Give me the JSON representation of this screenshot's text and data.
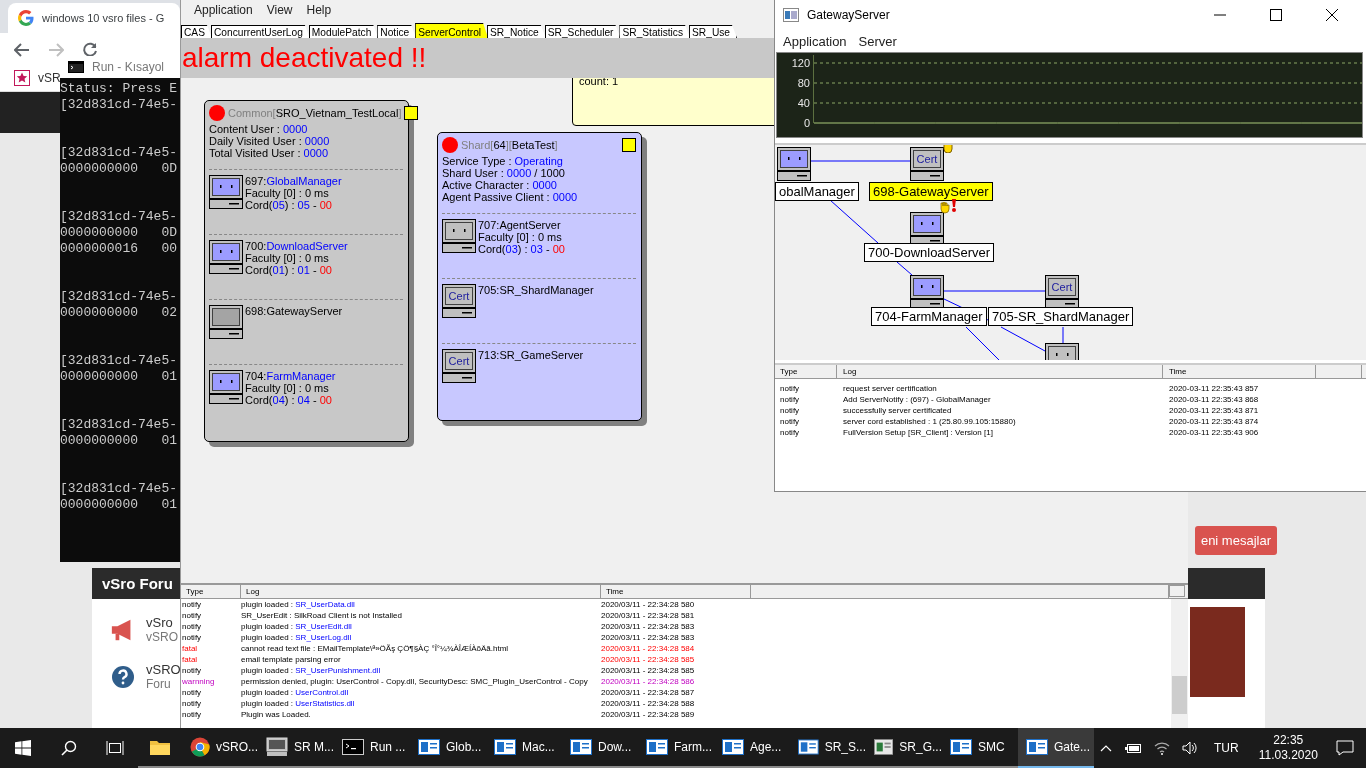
{
  "browser": {
    "tab_title": "windows 10 vsro files - G",
    "bookmark": "vSR",
    "new_messages_button": "eni mesajlar",
    "forum": {
      "title": "vSro Foru",
      "items": [
        {
          "kind": "announce",
          "title": "vSro",
          "subtitle": "vSRO"
        },
        {
          "kind": "help",
          "title": "vSRO",
          "subtitle": "Foru"
        }
      ]
    }
  },
  "console": {
    "title": "Run - Kısayol",
    "blocks": [
      [
        "Status: Press E",
        "[32d831cd-74e5-"
      ],
      [
        "[32d831cd-74e5-",
        "0000000000   0D"
      ],
      [
        "[32d831cd-74e5-",
        "0000000000   0D",
        "0000000016   00"
      ],
      [
        "[32d831cd-74e5-",
        "0000000000   02"
      ],
      [
        "[32d831cd-74e5-",
        "0000000000   01"
      ],
      [
        "[32d831cd-74e5-",
        "0000000000   01"
      ],
      [
        "[32d831cd-74e5-",
        "0000000000   01"
      ]
    ]
  },
  "smc": {
    "menu": [
      "Application",
      "View",
      "Help"
    ],
    "tabs": [
      {
        "label": "CAS",
        "selected": false
      },
      {
        "label": "ConcurrentUserLog",
        "selected": false
      },
      {
        "label": "ModulePatch",
        "selected": false
      },
      {
        "label": "Notice",
        "selected": false
      },
      {
        "label": "ServerControl",
        "selected": true
      },
      {
        "label": "SR_Notice",
        "selected": false
      },
      {
        "label": "SR_Scheduler",
        "selected": false
      },
      {
        "label": "SR_Statistics",
        "selected": false
      },
      {
        "label": "SR_Use",
        "selected": false
      }
    ],
    "alarm": "alarm deactivated !!",
    "note": "count: 1",
    "panels": [
      {
        "kind": "common",
        "color": "#ff0000",
        "flag": true,
        "header": [
          {
            "text": "Common[",
            "kind": "muted"
          },
          {
            "text": "SRO_Vietnam_TestLocal",
            "kind": "plain"
          },
          {
            "text": "]",
            "kind": "muted"
          }
        ],
        "stats": [
          [
            {
              "text": "Content User : ",
              "kind": "plain"
            },
            {
              "text": "0000",
              "kind": "link"
            }
          ],
          [
            {
              "text": "Daily Visited User : ",
              "kind": "plain"
            },
            {
              "text": "0000",
              "kind": "link"
            }
          ],
          [
            {
              "text": "Total Visited User : ",
              "kind": "plain"
            },
            {
              "text": "0000",
              "kind": "link"
            }
          ]
        ],
        "servers": [
          {
            "kind": "online",
            "lines": [
              [
                {
                  "text": "697:",
                  "kind": "plain"
                },
                {
                  "text": "GlobalManager",
                  "kind": "link"
                }
              ],
              [
                {
                  "text": "Faculty [0] : 0 ms",
                  "kind": "plain"
                }
              ],
              [
                {
                  "text": "Cord(",
                  "kind": "plain"
                },
                {
                  "text": "05",
                  "kind": "link"
                },
                {
                  "text": ") : ",
                  "kind": "plain"
                },
                {
                  "text": "05",
                  "kind": "link"
                },
                {
                  "text": " - ",
                  "kind": "plain"
                },
                {
                  "text": "00",
                  "kind": "alert"
                }
              ]
            ]
          },
          {
            "kind": "online",
            "lines": [
              [
                {
                  "text": "700:",
                  "kind": "plain"
                },
                {
                  "text": "DownloadServer",
                  "kind": "link"
                }
              ],
              [
                {
                  "text": "Faculty [0] : 0 ms",
                  "kind": "plain"
                }
              ],
              [
                {
                  "text": "Cord(",
                  "kind": "plain"
                },
                {
                  "text": "01",
                  "kind": "link"
                },
                {
                  "text": ") : ",
                  "kind": "plain"
                },
                {
                  "text": "01",
                  "kind": "link"
                },
                {
                  "text": " - ",
                  "kind": "plain"
                },
                {
                  "text": "00",
                  "kind": "alert"
                }
              ]
            ]
          },
          {
            "kind": "unknown",
            "lines": [
              [
                {
                  "text": "698:GatewayServer",
                  "kind": "plain"
                }
              ]
            ]
          },
          {
            "kind": "online",
            "lines": [
              [
                {
                  "text": "704:",
                  "kind": "plain"
                },
                {
                  "text": "FarmManager",
                  "kind": "link"
                }
              ],
              [
                {
                  "text": "Faculty [0] : 0 ms",
                  "kind": "plain"
                }
              ],
              [
                {
                  "text": "Cord(",
                  "kind": "plain"
                },
                {
                  "text": "04",
                  "kind": "link"
                },
                {
                  "text": ") : ",
                  "kind": "plain"
                },
                {
                  "text": "04",
                  "kind": "link"
                },
                {
                  "text": " - ",
                  "kind": "plain"
                },
                {
                  "text": "00",
                  "kind": "alert"
                }
              ]
            ]
          }
        ]
      },
      {
        "kind": "shard",
        "color": "#ff0000",
        "flag": true,
        "header": [
          {
            "text": "Shard[",
            "kind": "muted"
          },
          {
            "text": "64",
            "kind": "plain"
          },
          {
            "text": "][",
            "kind": "muted"
          },
          {
            "text": "BetaTest",
            "kind": "plain"
          },
          {
            "text": "]",
            "kind": "muted"
          }
        ],
        "stats": [
          [
            {
              "text": "Service Type : ",
              "kind": "plain"
            },
            {
              "text": "Operating",
              "kind": "link"
            }
          ],
          [
            {
              "text": "Shard User : ",
              "kind": "plain"
            },
            {
              "text": "0000",
              "kind": "link"
            },
            {
              "text": " / 1000",
              "kind": "plain"
            }
          ],
          [
            {
              "text": "Active Character : ",
              "kind": "plain"
            },
            {
              "text": "0000",
              "kind": "link"
            }
          ],
          [
            {
              "text": "Agent Passive Client : ",
              "kind": "plain"
            },
            {
              "text": "0000",
              "kind": "link"
            }
          ]
        ],
        "servers": [
          {
            "kind": "offline",
            "lines": [
              [
                {
                  "text": "707:AgentServer",
                  "kind": "plain"
                }
              ],
              [
                {
                  "text": "Faculty [0] : 0 ms",
                  "kind": "plain"
                }
              ],
              [
                {
                  "text": "Cord(",
                  "kind": "plain"
                },
                {
                  "text": "03",
                  "kind": "link"
                },
                {
                  "text": ") : ",
                  "kind": "plain"
                },
                {
                  "text": "03",
                  "kind": "link"
                },
                {
                  "text": " - ",
                  "kind": "plain"
                },
                {
                  "text": "00",
                  "kind": "alert"
                }
              ]
            ]
          },
          {
            "kind": "cert",
            "screen_text": "Cert",
            "lines": [
              [
                {
                  "text": "705:SR_ShardManager",
                  "kind": "plain"
                }
              ]
            ]
          },
          {
            "kind": "cert",
            "screen_text": "Cert",
            "lines": [
              [
                {
                  "text": "713:SR_GameServer",
                  "kind": "plain"
                }
              ]
            ]
          }
        ]
      }
    ],
    "log": {
      "columns": [
        "Type",
        "Log",
        "Time"
      ],
      "rows": [
        {
          "kind": "notify",
          "type": "notify",
          "log": [
            {
              "text": "plugin loaded : ",
              "kind": "plain"
            },
            {
              "text": "SR_UserData.dll",
              "kind": "link"
            }
          ],
          "time": "2020/03/11 - 22:34:28 580"
        },
        {
          "kind": "notify",
          "type": "notify",
          "log": [
            {
              "text": "SR_UserEdit : SilkRoad Client is not Installed",
              "kind": "plain"
            }
          ],
          "time": "2020/03/11 - 22:34:28 581"
        },
        {
          "kind": "notify",
          "type": "notify",
          "log": [
            {
              "text": "plugin loaded : ",
              "kind": "plain"
            },
            {
              "text": "SR_UserEdit.dll",
              "kind": "link"
            }
          ],
          "time": "2020/03/11 - 22:34:28 583"
        },
        {
          "kind": "notify",
          "type": "notify",
          "log": [
            {
              "text": "plugin loaded : ",
              "kind": "plain"
            },
            {
              "text": "SR_UserLog.dll",
              "kind": "link"
            }
          ],
          "time": "2020/03/11 - 22:34:28 583"
        },
        {
          "kind": "fatal",
          "type": "fatal",
          "log": [
            {
              "text": "cannot read text file : EMailTemplate\\ª»ÖÃş ÇÖ¶§ÀÇ °Î°¼¾ÀÎÆÍÀõÄã.html",
              "kind": "plain"
            }
          ],
          "time": "2020/03/11 - 22:34:28 584"
        },
        {
          "kind": "fatal",
          "type": "fatal",
          "log": [
            {
              "text": "email template parsing error",
              "kind": "plain"
            }
          ],
          "time": "2020/03/11 - 22:34:28 585"
        },
        {
          "kind": "notify",
          "type": "notify",
          "log": [
            {
              "text": "plugin loaded : ",
              "kind": "plain"
            },
            {
              "text": "SR_UserPunishment.dll",
              "kind": "link"
            }
          ],
          "time": "2020/03/11 - 22:34:28 585"
        },
        {
          "kind": "warning",
          "type": "warnning",
          "log": [
            {
              "text": "permission denied, plugin: UserControl - Copy.dll, SecurityDesc: SMC_Plugin_UserControl - Copy",
              "kind": "plain"
            }
          ],
          "time": "2020/03/11 - 22:34:28 586"
        },
        {
          "kind": "notify",
          "type": "notify",
          "log": [
            {
              "text": "plugin loaded : ",
              "kind": "plain"
            },
            {
              "text": "UserControl.dll",
              "kind": "link"
            }
          ],
          "time": "2020/03/11 - 22:34:28 587"
        },
        {
          "kind": "notify",
          "type": "notify",
          "log": [
            {
              "text": "plugin loaded : ",
              "kind": "plain"
            },
            {
              "text": "UserStatistics.dll",
              "kind": "link"
            }
          ],
          "time": "2020/03/11 - 22:34:28 588"
        },
        {
          "kind": "notify",
          "type": "notify",
          "log": [
            {
              "text": "Plugin was Loaded.",
              "kind": "plain"
            }
          ],
          "time": "2020/03/11 - 22:34:28 589"
        }
      ]
    }
  },
  "gateway": {
    "title": "GatewayServer",
    "menu": [
      "Application",
      "Server"
    ],
    "chart_data": {
      "type": "line",
      "yticks": [
        0,
        40,
        80,
        120
      ],
      "ylim": [
        0,
        120
      ],
      "values": [
        0,
        0,
        0,
        0,
        0,
        0,
        0,
        0,
        0,
        0
      ]
    },
    "nodes": [
      {
        "kind": "online",
        "label": "obalManager",
        "highlighted": false
      },
      {
        "kind": "cert",
        "screen_text": "Cert",
        "label": "698-GatewayServer",
        "highlighted": true
      },
      {
        "kind": "online",
        "label": "700-DownloadServer",
        "highlighted": false
      },
      {
        "kind": "online",
        "label": "704-FarmManager",
        "highlighted": false
      },
      {
        "kind": "cert",
        "screen_text": "Cert",
        "label": "705-SR_ShardManager",
        "highlighted": false
      },
      {
        "kind": "offline"
      }
    ],
    "log": {
      "columns": [
        "Type",
        "Log",
        "Time"
      ],
      "rows": [
        {
          "type": "notify",
          "log": "request server certification",
          "time": "2020-03-11 22:35:43 857"
        },
        {
          "type": "notify",
          "log": "Add ServerNotify : (697) - GlobalManager",
          "time": "2020-03-11 22:35:43 868"
        },
        {
          "type": "notify",
          "log": "successfully server certificated",
          "time": "2020-03-11 22:35:43 871"
        },
        {
          "type": "notify",
          "log": "server cord established : 1 (25.80.99.105:15880)",
          "time": "2020-03-11 22:35:43 874"
        },
        {
          "type": "notify",
          "log": "FullVersion Setup [SR_Client] : Version [1]",
          "time": "2020-03-11 22:35:43 906"
        }
      ]
    }
  },
  "taskbar": {
    "items": [
      {
        "kind": "explorer",
        "selected": false
      },
      {
        "kind": "chrome",
        "label": "vSRO...",
        "selected": false
      },
      {
        "kind": "monitor",
        "label": "SR M...",
        "selected": false
      },
      {
        "kind": "console",
        "label": "Run ...",
        "selected": false
      },
      {
        "kind": "app",
        "label": "Glob...",
        "selected": false
      },
      {
        "kind": "app",
        "label": "Mac...",
        "selected": false
      },
      {
        "kind": "app",
        "label": "Dow...",
        "selected": false
      },
      {
        "kind": "app",
        "label": "Farm...",
        "selected": false
      },
      {
        "kind": "app",
        "label": "Age...",
        "selected": false
      },
      {
        "kind": "app",
        "label": "SR_S...",
        "selected": false
      },
      {
        "kind": "sheet",
        "label": "SR_G...",
        "selected": false
      },
      {
        "kind": "app",
        "label": "SMC",
        "selected": false
      },
      {
        "kind": "app",
        "label": "Gate...",
        "selected": true
      }
    ],
    "language": "TUR",
    "time": "22:35",
    "date": "11.03.2020"
  }
}
